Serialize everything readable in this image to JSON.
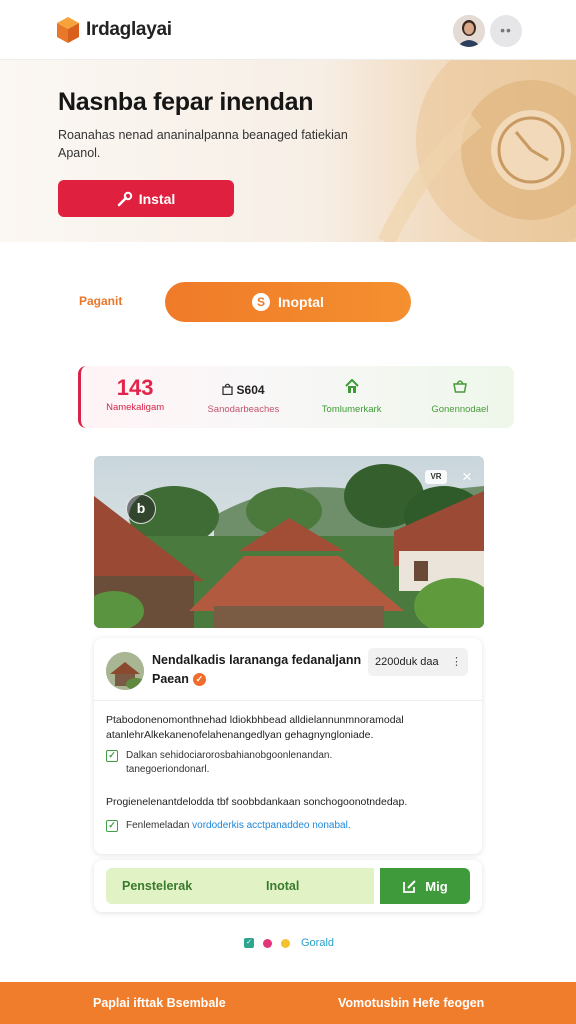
{
  "header": {
    "app_title": "Irdaglayai",
    "logo_icon": "box-icon",
    "avatar_icon": "user-avatar",
    "more_label": "••"
  },
  "hero": {
    "title": "Nasnba fepar inendan",
    "subtitle": "Roanahas nenad ananinalpanna beanaged fatiekian Apanol.",
    "button_label": "Instal",
    "button_icon": "wrench-icon"
  },
  "install_row": {
    "label": "Paganit",
    "pill_label": "Inoptal",
    "pill_icon": "S"
  },
  "stats": [
    {
      "value": "143",
      "label": "Namekaligam",
      "icon": ""
    },
    {
      "value": "S604",
      "label": "Sanodarbeaches",
      "icon": "bag-icon"
    },
    {
      "value": "",
      "label": "Tomlumerkark",
      "icon": "home-icon"
    },
    {
      "value": "",
      "label": "Gonennodael",
      "icon": "cart-icon"
    }
  ],
  "photo": {
    "badge": "b",
    "chip": "VR",
    "close": "×"
  },
  "detail": {
    "title": "Nendalkadis larananga fedanaljann",
    "subtitle": "Paean",
    "size": "2200duk daa",
    "description": "Ptabodonenomonthnehad ldiokbhbead alldielannunmnoramodal atanlehrAlkekanenofelahenangedlyan gehagnyngloniade.",
    "check_1": "Dalkan sehidociarorosbahianobgoonlenandan. tanegoeriondonarl.",
    "progress_text": "Progienelenantdelodda tbf soobbdankaan sonchogoonotndedap.",
    "check_2_lead": "Fenlemeladan",
    "check_2_link": "vordoderkis acctpanaddeo nonabal."
  },
  "actions": {
    "left_label": "Penstelerak",
    "center_label": "Inotal",
    "right_label": "Mig",
    "right_icon": "edit-icon"
  },
  "pager": {
    "label": "Gorald",
    "dot_colors": [
      "#2fa58e",
      "#e2357a",
      "#f2c12e"
    ]
  },
  "footer": {
    "left": "Paplai ifttak Bsembale",
    "right": "Vomotusbin Hefe feogen"
  },
  "colors": {
    "accent_orange": "#ef7d2c",
    "accent_red": "#e0203f",
    "accent_green": "#3e9a3a"
  }
}
